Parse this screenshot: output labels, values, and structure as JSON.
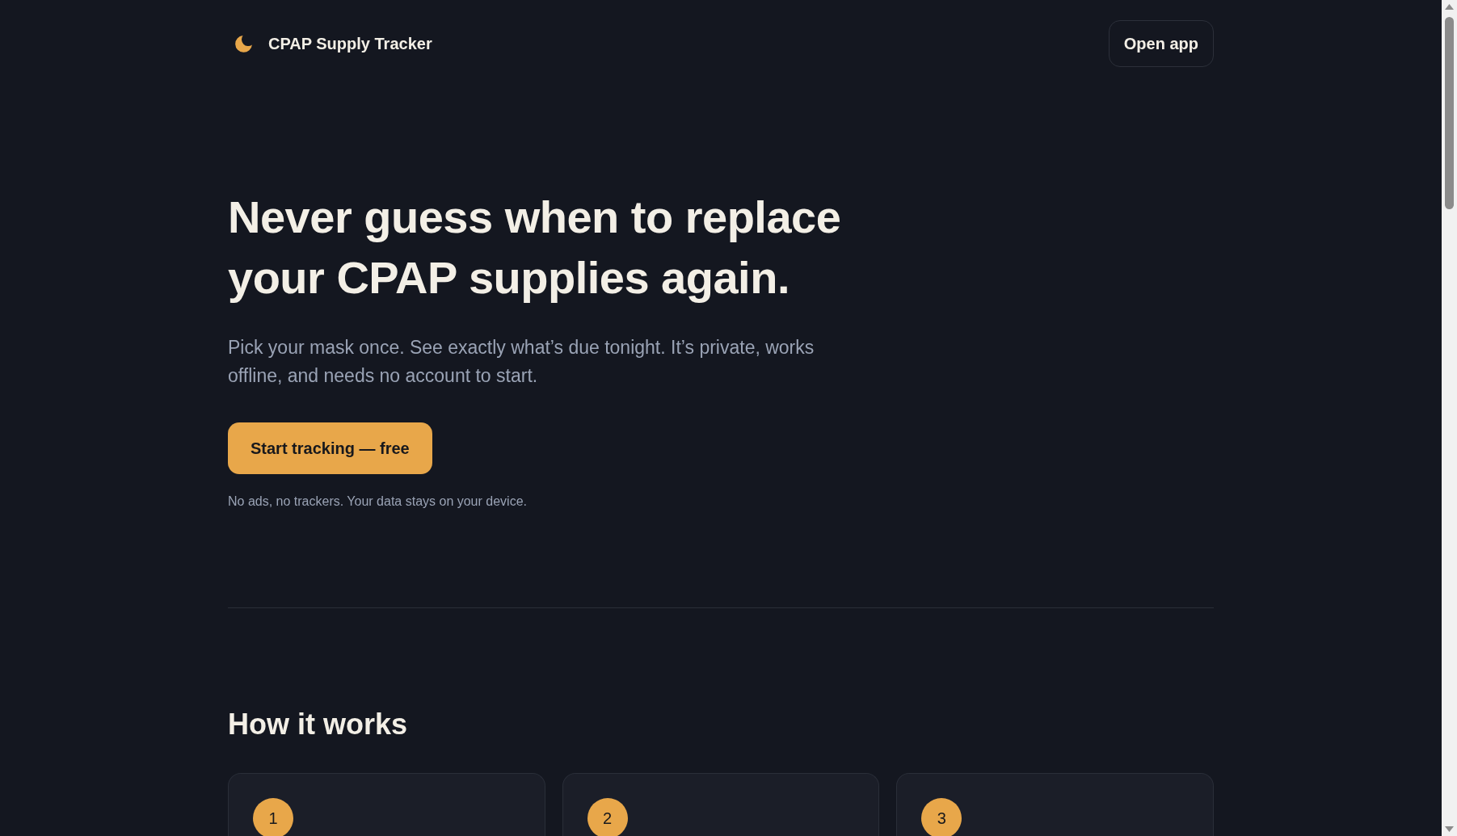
{
  "header": {
    "brand": "CPAP Supply Tracker",
    "button": "Open app"
  },
  "hero": {
    "title": "Never guess when to replace your CPAP supplies again.",
    "subtitle": "Pick your mask once. See exactly what’s due tonight. It’s private, works offline, and needs no account to start.",
    "cta": "Start tracking — free",
    "note": "No ads, no trackers. Your data stays on your device."
  },
  "how_it_works": {
    "heading": "How it works",
    "steps": [
      {
        "number": "1"
      },
      {
        "number": "2"
      },
      {
        "number": "3"
      }
    ]
  }
}
